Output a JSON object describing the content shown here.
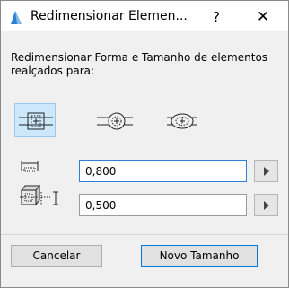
{
  "window": {
    "title": "Redimensionar Elemen...",
    "help_label": "?",
    "close_label": "✕"
  },
  "description": "Redimensionar Forma e Tamanho de elementos realçados para:",
  "modes": [
    {
      "icon": "resize-rectangle-icon",
      "selected": true
    },
    {
      "icon": "resize-circle-icon",
      "selected": false
    },
    {
      "icon": "resize-ellipse-icon",
      "selected": false
    }
  ],
  "fields": {
    "width_value": "0,800",
    "height_value": "0,500"
  },
  "buttons": {
    "cancel_label": "Cancelar",
    "ok_label": "Novo Tamanho"
  },
  "colors": {
    "selected_bg": "#cde8fb",
    "focus_border": "#2f7fd6",
    "default_button_border": "#0078d7",
    "app_icon_blue": "#2a7fd4"
  }
}
